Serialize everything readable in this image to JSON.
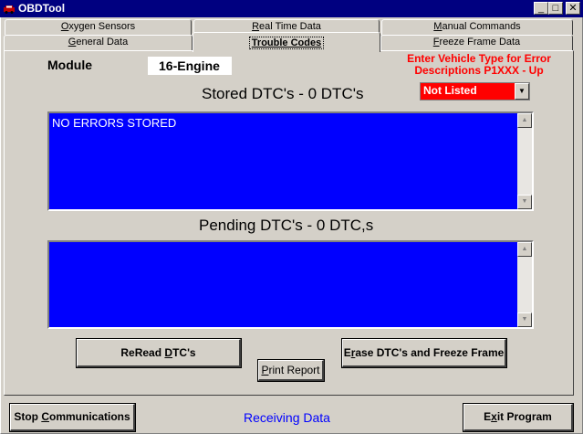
{
  "window": {
    "title": "OBDTool",
    "minimize_icon": "minimize-icon",
    "maximize_icon": "maximize-icon",
    "close_icon": "close-icon",
    "minimize_glyph": "_",
    "maximize_glyph": "□",
    "close_glyph": "✕"
  },
  "tabs": {
    "oxygen": {
      "pre": "",
      "u": "O",
      "post": "xygen Sensors"
    },
    "realtime": {
      "pre": "",
      "u": "R",
      "post": "eal Time Data"
    },
    "manual": {
      "pre": "",
      "u": "M",
      "post": "anual Commands"
    },
    "general": {
      "pre": "",
      "u": "G",
      "post": "eneral Data"
    },
    "trouble": {
      "label": "Trouble Codes"
    },
    "freeze": {
      "pre": "",
      "u": "F",
      "post": "reeze Frame Data"
    }
  },
  "module": {
    "label": "Module",
    "value": "16-Engine"
  },
  "vehicle": {
    "note_line1": "Enter Vehicle Type for Error",
    "note_line2": "Descriptions P1XXX - Up",
    "selected": "Not Listed",
    "arrow": "▼"
  },
  "stored": {
    "heading": "Stored DTC's - 0 DTC's",
    "text": "NO ERRORS STORED"
  },
  "pending": {
    "heading": "Pending DTC's -  0 DTC,s"
  },
  "scroll": {
    "up": "▲",
    "down": "▼"
  },
  "buttons": {
    "reread": {
      "pre": "ReRead ",
      "u": "D",
      "post": "TC's"
    },
    "erase": {
      "pre": "E",
      "u": "r",
      "post": "ase DTC's and Freeze Frame"
    },
    "print": {
      "pre": "",
      "u": "P",
      "post": "rint Report"
    },
    "stop": {
      "pre": "Stop ",
      "u": "C",
      "post": "ommunications"
    },
    "exit": {
      "pre": "E",
      "u": "x",
      "post": "it Program"
    }
  },
  "status": "Receiving Data",
  "colors": {
    "titlebar": "#000080",
    "list_background": "#0000ff",
    "alert_red": "#ff0000",
    "status_blue": "#0000ff",
    "face": "#d4d0c8"
  }
}
